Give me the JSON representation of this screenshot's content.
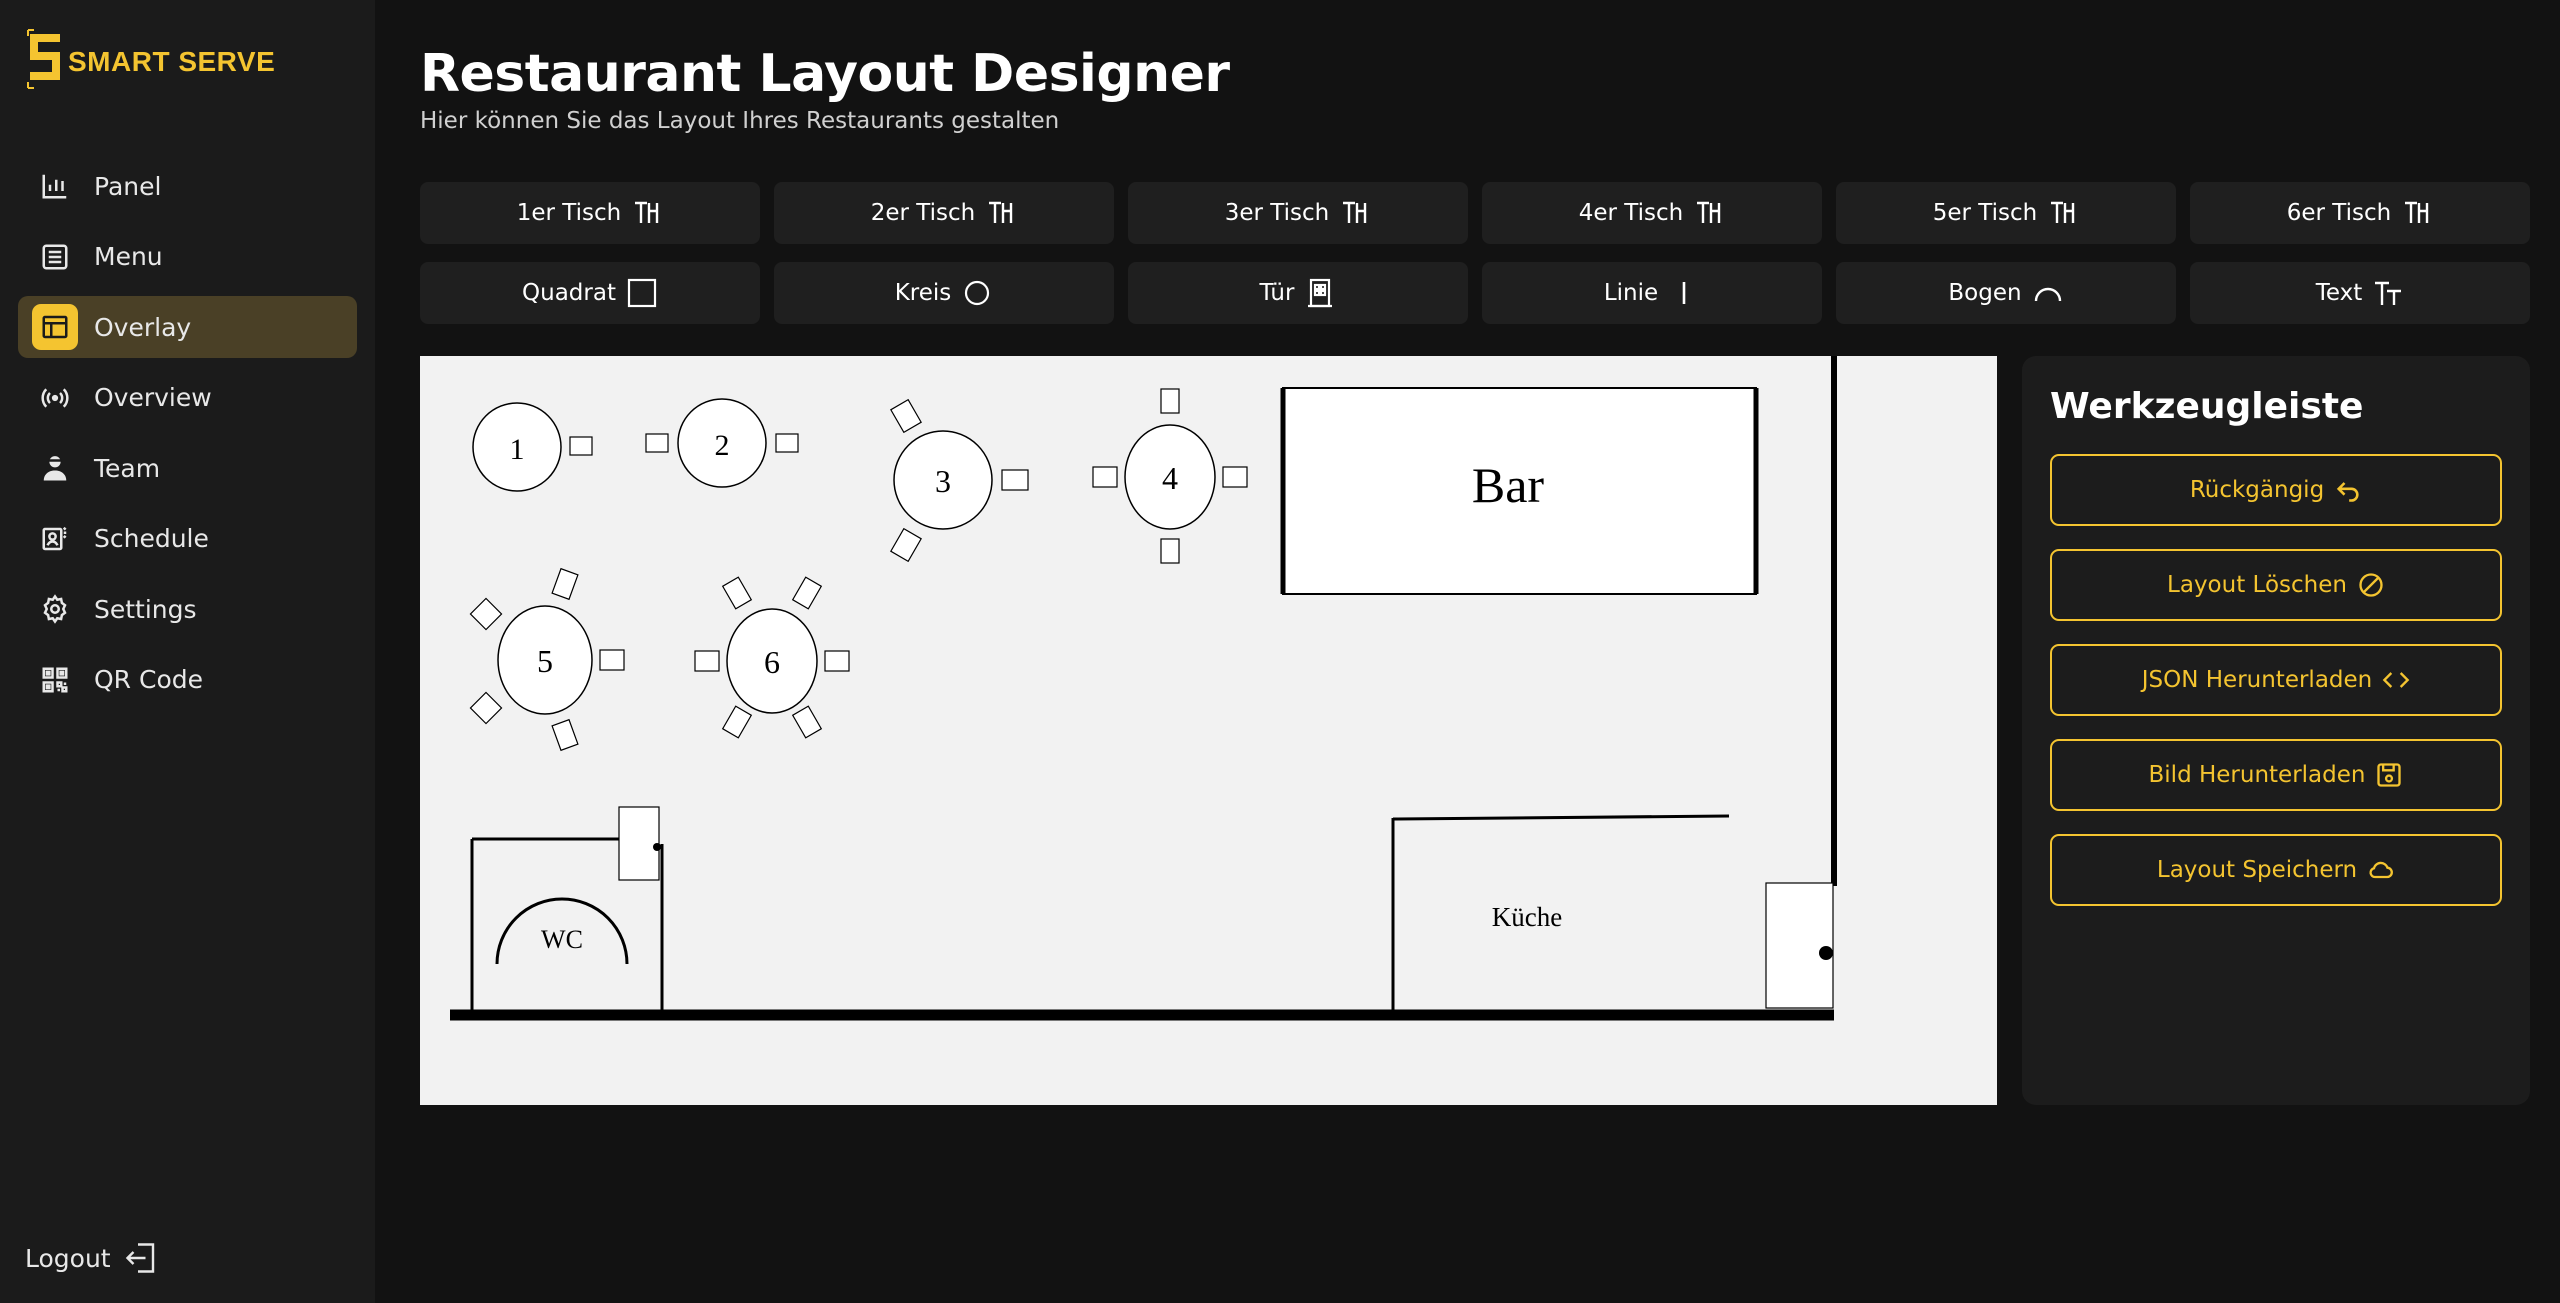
{
  "brand": {
    "name": "SMART SERVE",
    "color": "#f4c430"
  },
  "nav": {
    "items": [
      {
        "label": "Panel",
        "icon": "bar-chart-icon",
        "active": false
      },
      {
        "label": "Menu",
        "icon": "menu-list-icon",
        "active": false
      },
      {
        "label": "Overlay",
        "icon": "layout-table-icon",
        "active": true
      },
      {
        "label": "Overview",
        "icon": "broadcast-icon",
        "active": false
      },
      {
        "label": "Team",
        "icon": "team-user-icon",
        "active": false
      },
      {
        "label": "Schedule",
        "icon": "schedule-icon",
        "active": false
      },
      {
        "label": "Settings",
        "icon": "gear-icon",
        "active": false
      },
      {
        "label": "QR Code",
        "icon": "qr-code-icon",
        "active": false
      }
    ],
    "logout_label": "Logout"
  },
  "header": {
    "title": "Restaurant Layout Designer",
    "subtitle": "Hier können Sie das Layout Ihres Restaurants gestalten"
  },
  "tools": {
    "row1": [
      {
        "label": "1er Tisch",
        "icon": "table-icon"
      },
      {
        "label": "2er Tisch",
        "icon": "table-icon"
      },
      {
        "label": "3er Tisch",
        "icon": "table-icon"
      },
      {
        "label": "4er Tisch",
        "icon": "table-icon"
      },
      {
        "label": "5er Tisch",
        "icon": "table-icon"
      },
      {
        "label": "6er Tisch",
        "icon": "table-icon"
      }
    ],
    "row2": [
      {
        "label": "Quadrat",
        "icon": "square-icon"
      },
      {
        "label": "Kreis",
        "icon": "circle-icon"
      },
      {
        "label": "Tür",
        "icon": "door-icon"
      },
      {
        "label": "Linie",
        "icon": "line-icon"
      },
      {
        "label": "Bogen",
        "icon": "arc-icon"
      },
      {
        "label": "Text",
        "icon": "text-icon"
      }
    ]
  },
  "canvas": {
    "tables": [
      "1",
      "2",
      "3",
      "4",
      "5",
      "6"
    ],
    "bar_label": "Bar",
    "wc_label": "WC",
    "kitchen_label": "Küche"
  },
  "toolbar": {
    "title": "Werkzeugleiste",
    "buttons": [
      {
        "label": "Rückgängig",
        "icon": "undo-icon"
      },
      {
        "label": "Layout Löschen",
        "icon": "clear-icon"
      },
      {
        "label": "JSON Herunterladen",
        "icon": "code-icon"
      },
      {
        "label": "Bild Herunterladen",
        "icon": "save-icon"
      },
      {
        "label": "Layout Speichern",
        "icon": "cloud-icon"
      }
    ]
  }
}
